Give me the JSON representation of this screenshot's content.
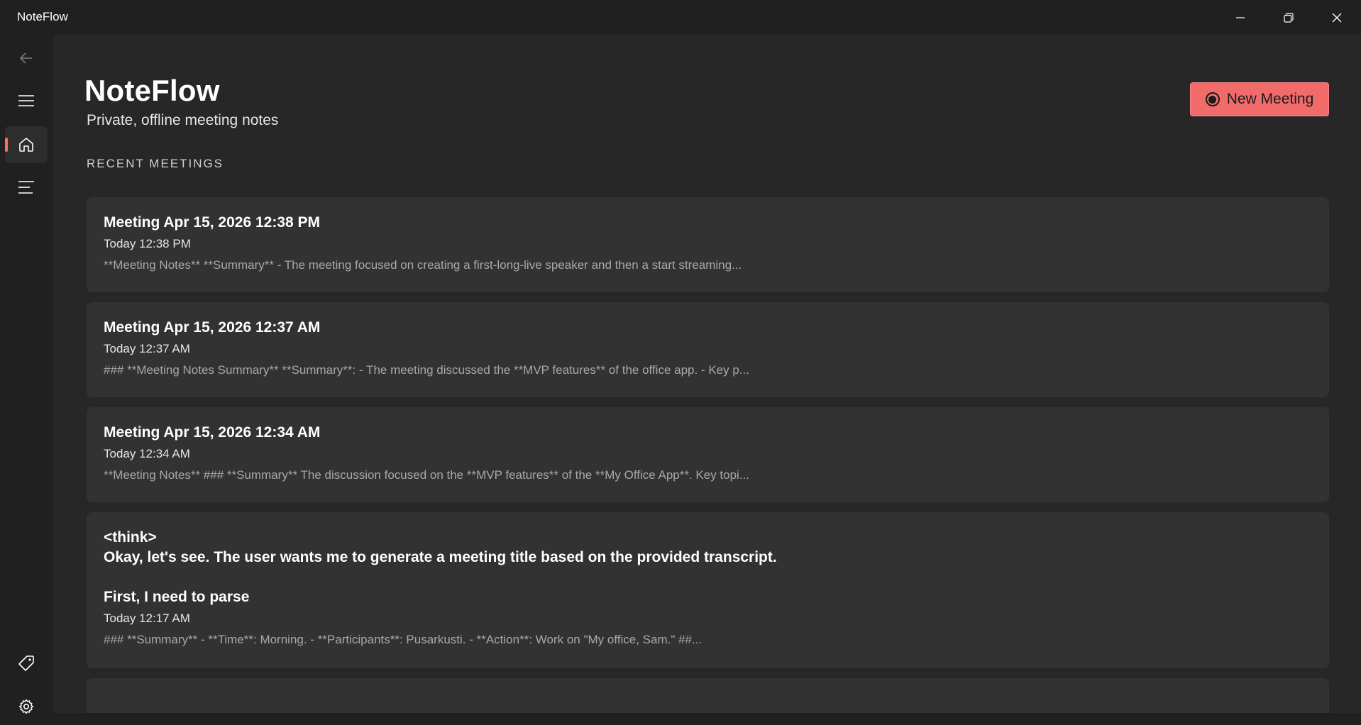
{
  "window": {
    "title": "NoteFlow",
    "controls": [
      "minimize-icon",
      "restore-icon",
      "close-icon"
    ]
  },
  "sidebar": {
    "items": [
      {
        "name": "back",
        "icon": "back-arrow-icon"
      },
      {
        "name": "menu",
        "icon": "hamburger-icon"
      },
      {
        "name": "home",
        "icon": "home-icon",
        "active": true
      },
      {
        "name": "meetings-list",
        "icon": "list-icon"
      }
    ],
    "bottom_items": [
      {
        "name": "tags",
        "icon": "tag-icon"
      },
      {
        "name": "settings",
        "icon": "gear-icon"
      }
    ]
  },
  "header": {
    "title": "NoteFlow",
    "subtitle": "Private, offline meeting notes",
    "new_meeting_label": "New Meeting"
  },
  "recent": {
    "section_title": "RECENT MEETINGS",
    "meetings": [
      {
        "title": "Meeting Apr 15, 2026 12:38 PM",
        "time": "Today 12:38 PM",
        "preview": "**Meeting Notes**   **Summary**   - The meeting focused on creating a first-long-live speaker and then a start streaming..."
      },
      {
        "title": "Meeting Apr 15, 2026 12:37 AM",
        "time": "Today 12:37 AM",
        "preview": "### **Meeting Notes Summary**   **Summary**:   - The meeting discussed the **MVP features** of the office app.   - Key p..."
      },
      {
        "title": "Meeting Apr 15, 2026 12:34 AM",
        "time": "Today 12:34 AM",
        "preview": "**Meeting Notes**   ### **Summary**   The discussion focused on the **MVP features** of the **My Office App**. Key topi..."
      },
      {
        "title": "<think>\nOkay, let's see. The user wants me to generate a meeting title based on the provided transcript.\n\nFirst, I need to parse",
        "time": "Today 12:17 AM",
        "preview": "### **Summary**   - **Time**: Morning.   - **Participants**: Pusarkusti.   - **Action**: Work on \"My office, Sam.\"   ##..."
      }
    ]
  },
  "colors": {
    "accent": "#f26b6b",
    "background": "#202020",
    "content_bg": "#272727",
    "card_bg": "#323232"
  }
}
